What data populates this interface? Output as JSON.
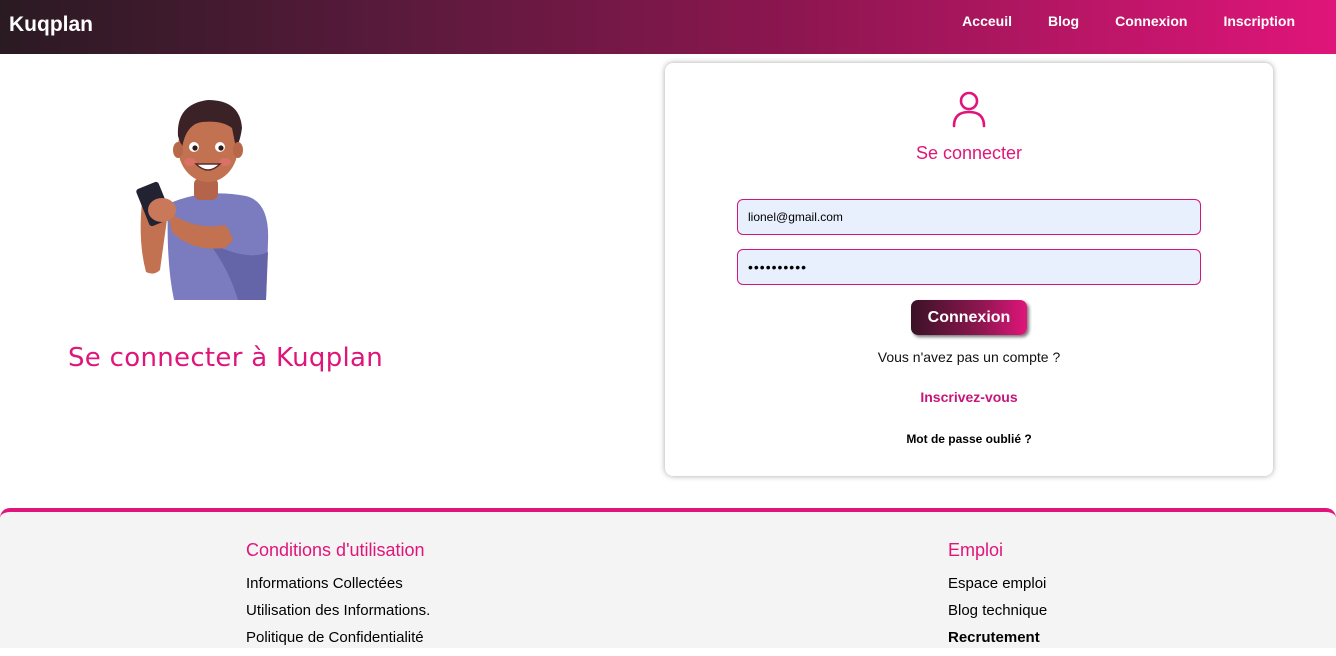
{
  "navbar": {
    "brand": "Kuqplan",
    "links": [
      "Acceuil",
      "Blog",
      "Connexion",
      "Inscription"
    ]
  },
  "hero": {
    "title": "Se connecter à Kuqplan"
  },
  "login": {
    "title": "Se connecter",
    "email_value": "lionel@gmail.com",
    "password_value": "••••••••••",
    "button_label": "Connexion",
    "no_account_text": "Vous n'avez pas un compte ?",
    "signup_label": "Inscrivez-vous",
    "forgot_label": "Mot de passe oublié ?"
  },
  "footer": {
    "left": {
      "heading": "Conditions d'utilisation",
      "links": [
        "Informations Collectées",
        "Utilisation des Informations.",
        "Politique de Confidentialité"
      ]
    },
    "right": {
      "heading": "Emploi",
      "links": [
        "Espace emploi",
        "Blog technique",
        "Recrutement"
      ]
    }
  },
  "colors": {
    "accent": "#e0157a",
    "nav_gradient_start": "#2a1a22",
    "footer_bg": "#f4f4f4",
    "input_bg": "#e8f0fe"
  },
  "icons": {
    "login": "user-icon",
    "illustration": "person-with-phone-illustration"
  }
}
